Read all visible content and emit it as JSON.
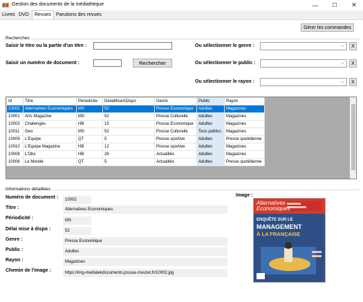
{
  "window": {
    "title": "Gestion des documents de la médiathèque",
    "minimize": "—",
    "maximize": "☐",
    "close": "✕"
  },
  "tabs": [
    {
      "label": "Livres"
    },
    {
      "label": "DVD"
    },
    {
      "label": "Revues",
      "active": true
    },
    {
      "label": "Parutions des revues"
    }
  ],
  "toolbar": {
    "manage_orders_label": "Gérer les commandes"
  },
  "search": {
    "group_label": "Recherches",
    "title_label": "Saisir le titre ou la partie d'un titre :",
    "title_value": "",
    "number_label": "Saisir un numéro de document :",
    "number_value": "",
    "search_button": "Rechercher",
    "genre_label": "Ou sélectionner le genre :",
    "public_label": "Ou sélectionner le public :",
    "rayon_label": "Ou sélectionner le rayon :",
    "clear_label": "X"
  },
  "table": {
    "columns": [
      "Id",
      "Titre",
      "Periodicite",
      "DelaiMiseADispo",
      "Genre",
      "Public",
      "Rayon"
    ],
    "rows": [
      {
        "id": "10002",
        "titre": "Alternatives Economiques",
        "periodicite": "MS",
        "delai": "52",
        "genre": "Presse Economique",
        "public": "Adultes",
        "rayon": "Magazines",
        "selected": true
      },
      {
        "id": "10001",
        "titre": "Arts Magazine",
        "periodicite": "MS",
        "delai": "52",
        "genre": "Presse Culturelle",
        "public": "Adultes",
        "rayon": "Magazines"
      },
      {
        "id": "10003",
        "titre": "Challenges",
        "periodicite": "HB",
        "delai": "15",
        "genre": "Presse Economique",
        "public": "Adultes",
        "rayon": "Magazines"
      },
      {
        "id": "10011",
        "titre": "Geo",
        "periodicite": "MS",
        "delai": "52",
        "genre": "Presse Culturelle",
        "public": "Tous publics",
        "rayon": "Magazines"
      },
      {
        "id": "10009",
        "titre": "L'Equipe",
        "periodicite": "QT",
        "delai": "5",
        "genre": "Presse sportive",
        "public": "Adultes",
        "rayon": "Presse quotidienne"
      },
      {
        "id": "10010",
        "titre": "L'Equipe Magazine",
        "periodicite": "HB",
        "delai": "12",
        "genre": "Presse sportive",
        "public": "Adultes",
        "rayon": "Magazines"
      },
      {
        "id": "10008",
        "titre": "L'Obs",
        "periodicite": "HB",
        "delai": "26",
        "genre": "Actualités",
        "public": "Adultes",
        "rayon": "Magazines"
      },
      {
        "id": "10006",
        "titre": "Le Monde",
        "periodicite": "QT",
        "delai": "5",
        "genre": "Actualités",
        "public": "Adultes",
        "rayon": "Presse quotidienne"
      }
    ]
  },
  "details": {
    "group_label": "Informations détaillées",
    "numero_label": "Numéro de document :",
    "numero_value": "10002",
    "titre_label": "Titre :",
    "titre_value": "Alternatives Economiques",
    "periodicite_label": "Périodicité :",
    "periodicite_value": "MS",
    "delai_label": "Délai mise à dispo :",
    "delai_value": "52",
    "genre_label": "Genre :",
    "genre_value": "Presse Economique",
    "public_label": "Public :",
    "public_value": "Adultes",
    "rayon_label": "Rayon :",
    "rayon_value": "Magazines",
    "image_path_label": "Chemin de l'image :",
    "image_path_value": "https://img-mediatekdocuments.jossua-creuzet.fr/10002.jpg",
    "image_label": "Image :"
  },
  "cover": {
    "masthead_line1": "Alternatives",
    "masthead_line2": "Economiques",
    "headline1": "ENQUÊTE SUR LE",
    "headline2": "MANAGEMENT",
    "headline3": "À LA FRANÇAISE",
    "accent_color": "#d63a2a",
    "bg_color": "#2e4f86"
  },
  "colors": {
    "selection": "#0078d7",
    "highlight_column": "#dbe9f7",
    "grid_background": "#ababab"
  }
}
